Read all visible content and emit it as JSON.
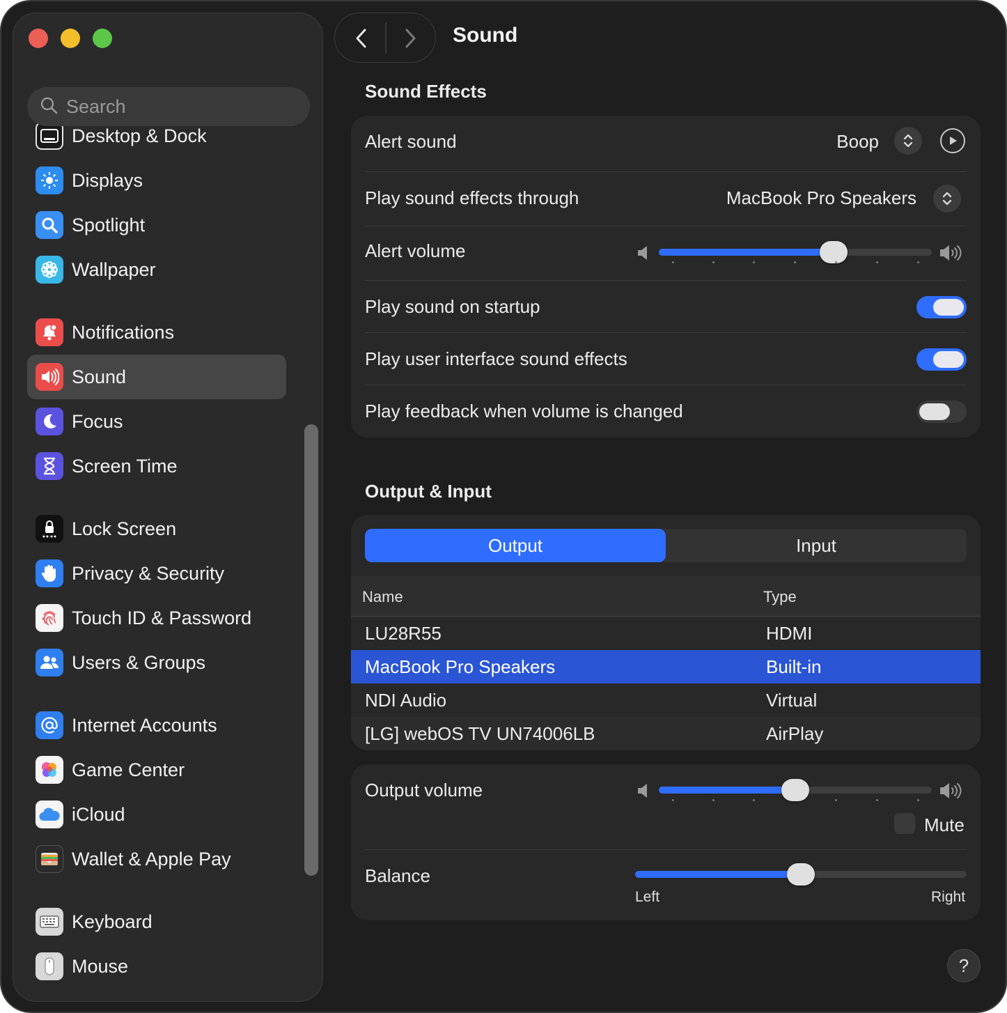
{
  "window": {
    "title": "Sound"
  },
  "search": {
    "placeholder": "Search"
  },
  "sidebar": {
    "items": [
      {
        "label": "Desktop & Dock",
        "icon": "desktop-dock-icon"
      },
      {
        "label": "Displays",
        "icon": "displays-icon"
      },
      {
        "label": "Spotlight",
        "icon": "spotlight-icon"
      },
      {
        "label": "Wallpaper",
        "icon": "wallpaper-icon"
      },
      {
        "label": "Notifications",
        "icon": "notifications-icon"
      },
      {
        "label": "Sound",
        "icon": "sound-icon",
        "selected": true
      },
      {
        "label": "Focus",
        "icon": "focus-icon"
      },
      {
        "label": "Screen Time",
        "icon": "screen-time-icon"
      },
      {
        "label": "Lock Screen",
        "icon": "lock-screen-icon"
      },
      {
        "label": "Privacy & Security",
        "icon": "privacy-hand-icon"
      },
      {
        "label": "Touch ID & Password",
        "icon": "fingerprint-icon"
      },
      {
        "label": "Users & Groups",
        "icon": "users-icon"
      },
      {
        "label": "Internet Accounts",
        "icon": "at-sign-icon"
      },
      {
        "label": "Game Center",
        "icon": "game-center-icon"
      },
      {
        "label": "iCloud",
        "icon": "icloud-icon"
      },
      {
        "label": "Wallet & Apple Pay",
        "icon": "wallet-icon"
      },
      {
        "label": "Keyboard",
        "icon": "keyboard-icon"
      },
      {
        "label": "Mouse",
        "icon": "mouse-icon"
      }
    ]
  },
  "sound_effects": {
    "title": "Sound Effects",
    "alert_sound": {
      "label": "Alert sound",
      "value": "Boop"
    },
    "play_through": {
      "label": "Play sound effects through",
      "value": "MacBook Pro Speakers"
    },
    "alert_volume": {
      "label": "Alert volume",
      "level": 0.64
    },
    "startup": {
      "label": "Play sound on startup",
      "on": true
    },
    "ui_effects": {
      "label": "Play user interface sound effects",
      "on": true
    },
    "feedback": {
      "label": "Play feedback when volume is changed",
      "on": false
    }
  },
  "output_input": {
    "title": "Output & Input",
    "tabs": {
      "output": "Output",
      "input": "Input",
      "active": "output"
    },
    "columns": {
      "name": "Name",
      "type": "Type"
    },
    "devices": [
      {
        "name": "LU28R55",
        "type": "HDMI"
      },
      {
        "name": "MacBook Pro Speakers",
        "type": "Built-in",
        "selected": true
      },
      {
        "name": "NDI Audio",
        "type": "Virtual"
      },
      {
        "name": "[LG] webOS TV UN74006LB",
        "type": "AirPlay"
      }
    ]
  },
  "volume": {
    "output_label": "Output volume",
    "output_level": 0.5,
    "mute_label": "Mute",
    "mute": false,
    "balance_label": "Balance",
    "balance_level": 0.5,
    "left_label": "Left",
    "right_label": "Right"
  },
  "help": {
    "label": "?"
  },
  "colors": {
    "accent": "#2f6dff",
    "selection": "#2a55d4",
    "background": "#1e1e1e"
  }
}
